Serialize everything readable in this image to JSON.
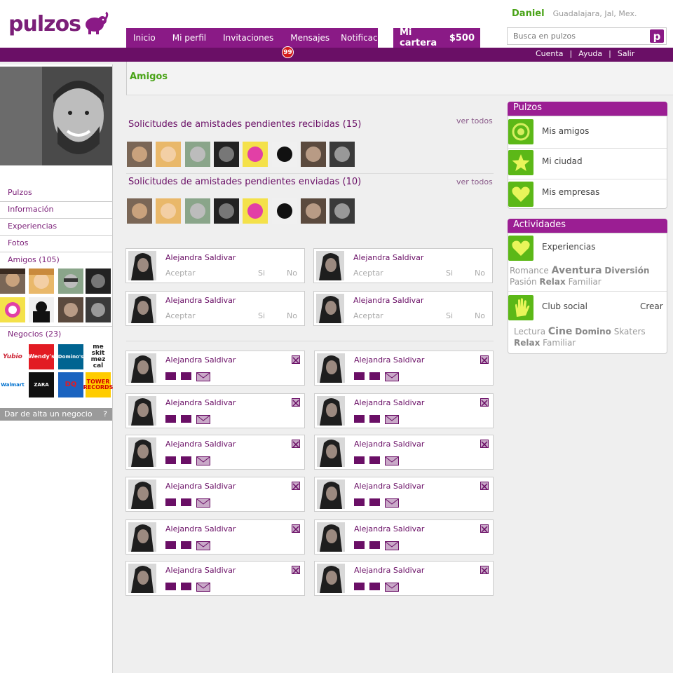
{
  "brand": {
    "name": "pulzos"
  },
  "nav": {
    "items": [
      {
        "label": "Inicio"
      },
      {
        "label": "Mi perfil"
      },
      {
        "label": "Invitaciones"
      },
      {
        "label": "Mensajes"
      },
      {
        "label": "Notificaciones"
      }
    ],
    "messages_badge": "99"
  },
  "wallet": {
    "label": "Mi cartera",
    "amount": "$500"
  },
  "user": {
    "name": "Daniel",
    "location": "Guadalajara, Jal, Mex."
  },
  "search": {
    "placeholder": "Busca en pulzos",
    "button": "p"
  },
  "toplinks": [
    "Cuenta",
    "Ayuda",
    "Salir"
  ],
  "sidebar": {
    "links": [
      "Pulzos",
      "Información",
      "Experiencias",
      "Fotos"
    ],
    "friends_label": "Amigos (105)",
    "business_label": "Negocios (23)",
    "businesses": [
      "Yubio",
      "Wendy's",
      "Domino's",
      "me skit mez cal",
      "Walmart",
      "ZARA",
      "DQ",
      "TOWER RECORDS"
    ],
    "add_business": "Dar de alta un negocio",
    "help": "?"
  },
  "main": {
    "title": "Amigos",
    "received_title": "Solicitudes de amistades pendientes recibidas (15)",
    "sent_title": "Solicitudes de amistades pendientes enviadas (10)",
    "see_all": "ver todos",
    "request_card": {
      "name": "Alejandra Saldivar",
      "accept": "Aceptar",
      "yes": "Si",
      "no": "No"
    },
    "friend_name": "Alejandra Saldivar"
  },
  "panels": {
    "pulzos": {
      "title": "Pulzos",
      "items": [
        "Mis amigos",
        "Mi ciudad",
        "Mis empresas"
      ]
    },
    "actividades": {
      "title": "Actividades",
      "experiencias": "Experiencias",
      "exp_tags": [
        "Romance",
        "Aventura",
        "Diversión",
        "Pasión",
        "Relax",
        "Familiar"
      ],
      "club": "Club social",
      "create": "Crear",
      "club_tags": [
        "Lectura",
        "Cine",
        "Domino",
        "Skaters",
        "Relax",
        "Familiar"
      ]
    }
  },
  "colors": {
    "brand_purple": "#8a1a86",
    "dark_purple": "#6a0f66",
    "green": "#5cb817",
    "name_green": "#49a317"
  }
}
